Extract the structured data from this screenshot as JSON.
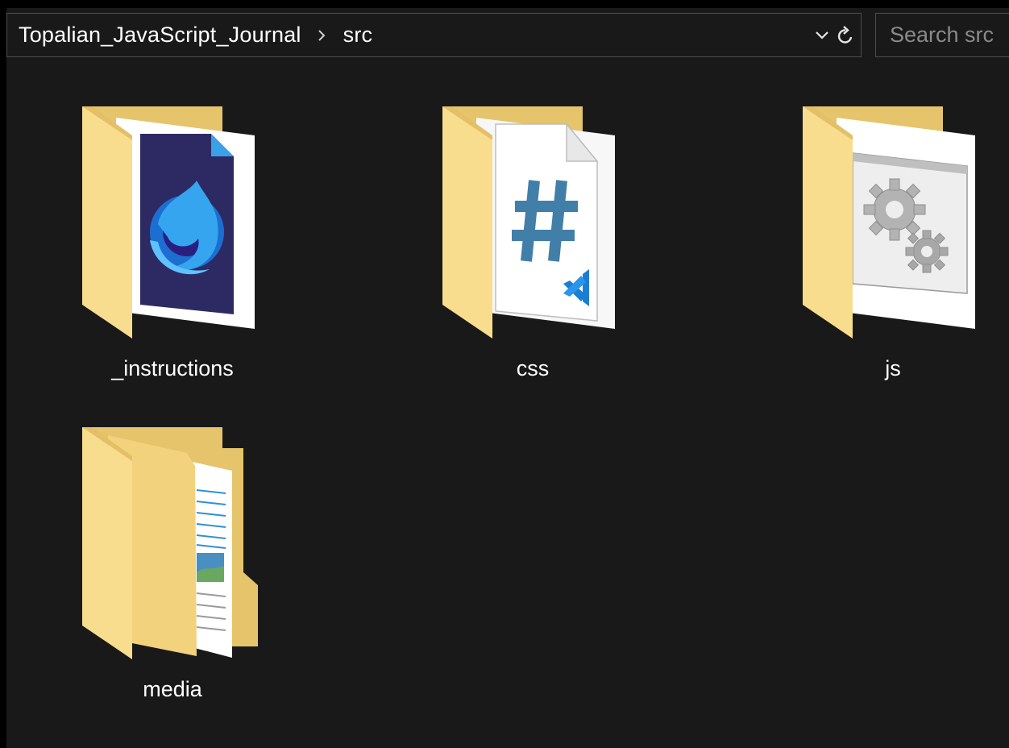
{
  "address_bar": {
    "breadcrumbs": [
      "Topalian_JavaScript_Journal",
      "src"
    ],
    "separator_icon": "chevron-right-icon",
    "dropdown_icon": "chevron-down-icon",
    "refresh_icon": "refresh-icon"
  },
  "search": {
    "placeholder": "Search src"
  },
  "items": [
    {
      "name": "_instructions",
      "icon": "folder-firefox-developer-icon"
    },
    {
      "name": "css",
      "icon": "folder-css-file-icon"
    },
    {
      "name": "js",
      "icon": "folder-gears-icon"
    },
    {
      "name": "media",
      "icon": "folder-documents-icon"
    }
  ],
  "colors": {
    "folder_back": "#e6c46b",
    "folder_front": "#f9dd8f",
    "background": "#191919",
    "text": "#ffffff"
  }
}
